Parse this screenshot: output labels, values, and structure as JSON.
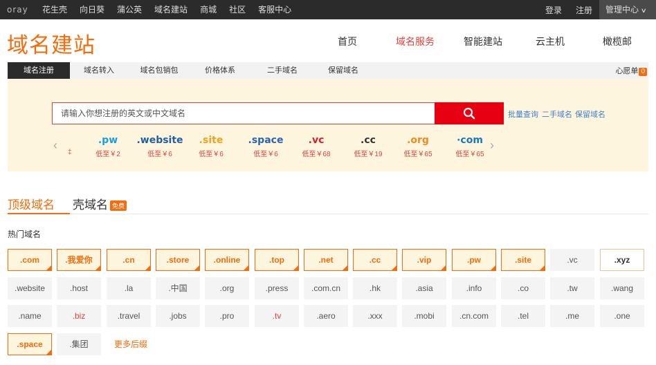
{
  "topbar": {
    "logo": "oray",
    "nav": [
      "花生壳",
      "向日葵",
      "蒲公英",
      "域名建站",
      "商城",
      "社区",
      "客服中心"
    ],
    "login": "登录",
    "register": "注册",
    "manage": "管理中心",
    "manage_icon": "chevron-down-icon"
  },
  "header": {
    "brand": "域名建站",
    "nav": [
      {
        "label": "首页",
        "active": false
      },
      {
        "label": "域名服务",
        "active": true
      },
      {
        "label": "智能建站",
        "active": false
      },
      {
        "label": "云主机",
        "active": false
      },
      {
        "label": "橄榄邮",
        "active": false
      }
    ]
  },
  "subnav": {
    "tabs": [
      {
        "label": "域名注册",
        "active": true
      },
      {
        "label": "域名转入",
        "active": false
      },
      {
        "label": "域名包销包",
        "active": false
      },
      {
        "label": "价格体系",
        "active": false
      },
      {
        "label": "二手域名",
        "active": false
      },
      {
        "label": "保留域名",
        "active": false
      }
    ],
    "wishlist": "心愿单",
    "wishlist_count": "0"
  },
  "search": {
    "placeholder": "请输入你想注册的英文或中文域名",
    "button_icon": "search-icon",
    "quick_links": [
      "批量查询",
      "二手域名",
      "保留域名"
    ]
  },
  "carousel": {
    "left_fragment": "‡",
    "items": [
      {
        "name": ".pw",
        "price": "低至￥2",
        "color": "#1a9de0"
      },
      {
        "name": ".website",
        "price": "低至￥6",
        "color": "#1f5fa8"
      },
      {
        "name": ".site",
        "price": "低至￥6",
        "color": "#f4a11b"
      },
      {
        "name": ".space",
        "price": "低至￥6",
        "color": "#2a63b8"
      },
      {
        "name": ".vc",
        "price": "低至￥68",
        "color": "#d8202a"
      },
      {
        "name": ".cc",
        "price": "低至￥19",
        "color": "#333333"
      },
      {
        "name": ".org",
        "price": "低至￥65",
        "color": "#f08a1c"
      },
      {
        "name": "·com",
        "price": "低至￥65",
        "color": "#1779c4"
      }
    ],
    "prev_icon": "chevron-left-icon",
    "next_icon": "chevron-right-icon"
  },
  "domain_tabs": {
    "top": "顶级域名",
    "shell": "壳域名",
    "shell_badge": "免费"
  },
  "hot": {
    "title": "热门域名",
    "rows": [
      [
        ".com",
        ".我爱你",
        ".cn",
        ".store",
        ".online",
        ".top",
        ".net",
        ".cc",
        ".vip",
        ".pw",
        ".site",
        ".vc",
        ".xyz"
      ],
      [
        ".website",
        ".host",
        ".la",
        ".中国",
        ".org",
        ".press",
        ".com.cn",
        ".hk",
        ".asia",
        ".info",
        ".co",
        ".tw",
        ".wang"
      ],
      [
        ".name",
        ".biz",
        ".travel",
        ".jobs",
        ".pro",
        ".tv",
        ".aero",
        ".xxx",
        ".mobi",
        ".cn.com",
        ".tel",
        ".me",
        ".one"
      ],
      [
        ".space",
        ".集团"
      ]
    ],
    "highlighted": [
      ".com",
      ".我爱你",
      ".cn",
      ".store",
      ".online",
      ".top",
      ".net",
      ".cc",
      ".vip",
      ".pw",
      ".site",
      ".space"
    ],
    "boxed": [
      ".xyz"
    ],
    "red": [
      ".biz",
      ".tv"
    ],
    "more": "更多后缀"
  },
  "colors": {
    "accent": "#f46c0b",
    "red": "#e2403a",
    "panel": "#fef5de",
    "topbar": "#2b2b2b"
  }
}
